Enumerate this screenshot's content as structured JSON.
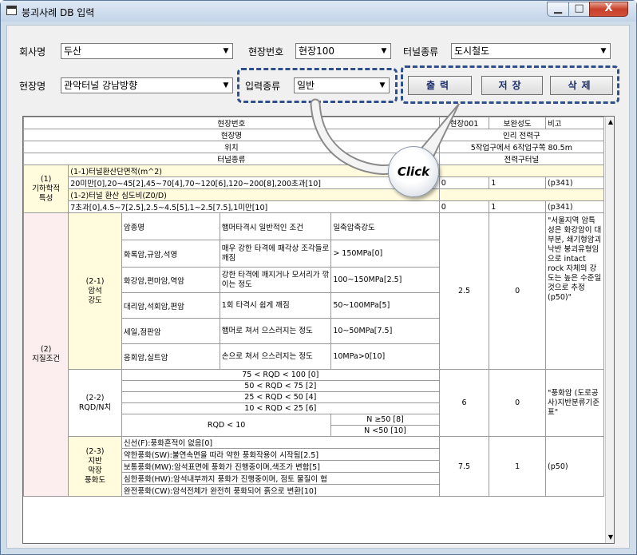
{
  "window": {
    "title": "붕괴사례 DB 입력",
    "min": "▁",
    "max": "□",
    "close": "X"
  },
  "form": {
    "company_label": "회사명",
    "company_value": "두산",
    "site_no_label": "현장번호",
    "site_no_value": "현장100",
    "tunnel_type_label": "터널종류",
    "tunnel_type_value": "도시철도",
    "site_name_label": "현장명",
    "site_name_value": "관악터널 강남방향",
    "input_type_label": "입력종류",
    "input_type_value": "일반"
  },
  "actions": {
    "print": "출력",
    "save": "저장",
    "delete": "삭제"
  },
  "overlay": {
    "click": "Click"
  },
  "grid": {
    "header": [
      {
        "label": "현장번호",
        "c1": "현장001",
        "c2": "보완성도",
        "c3": "비고"
      },
      {
        "label": "현장명",
        "value": "인리 전력구"
      },
      {
        "label": "위치",
        "value": "5작업구에서 6작업구쪽 80.5m"
      },
      {
        "label": "터널종류",
        "value": "전력구터널"
      }
    ],
    "geo": {
      "label": "(1)\n기하학적\n특성",
      "r1": "(1-1)터널환산단면적(m^2)",
      "r2": "20미만[0],20~45[2],45~70[4],70~120[6],120~200[8],200초과[10]",
      "r2_vals": [
        "0",
        "1",
        "(p341)"
      ],
      "r3": "(1-2)터널 환산 심도비(Z0/D)",
      "r4": "7초과[0],4.5~7[2.5],2.5~4.5[5],1~2.5[7.5],1미만[10]",
      "r4_vals": [
        "0",
        "1",
        "(p341)"
      ]
    },
    "ground": {
      "label": "(2)\n지질조건",
      "strength": {
        "label": "(2-1)\n암석\n강도",
        "col_heads": [
          "암종명",
          "햄머타격시 일반적인 조건",
          "일축압축강도"
        ],
        "rows": [
          [
            "화록암,규암,석영",
            "매우 강한 타격에 패각상 조각들로 깨짐",
            "> 150MPa[0]"
          ],
          [
            "화강암,편마암,역암",
            "강한 타격에 깨지거나 모서리가 깎이는 정도",
            "100~150MPa[2.5]"
          ],
          [
            "대리암,석회암,편암",
            "1회 타격시 쉽게 깨짐",
            "50~100MPa[5]"
          ],
          [
            "세일,점판암",
            "햄머로 쳐서 으스러지는 정도",
            "10~50MPa[7.5]"
          ],
          [
            "응회암,실트암",
            "손으로 쳐서 으스러지는 정도",
            "10MPa>0[10]"
          ]
        ],
        "v1": "2.5",
        "v2": "0",
        "note": "\"서울지역 암특성은 화강암이 대부분, 쇄기형암괴 낙반 붕괴유형임으로 intact rock 자체의 강도는 높은 수준일 것으로 추정(p50)\""
      },
      "rqd": {
        "label": "(2-2)\nRQD/N치",
        "rows": [
          "75 < RQD < 100 [0]",
          "50 < RQD < 75 [2]",
          "25 < RQD < 50 [4]",
          "10 < RQD < 25 [6]"
        ],
        "low": "RQD < 10",
        "n1": "N ≥50 [8]",
        "n2": "N <50 [10]",
        "v1": "6",
        "v2": "0",
        "note": "\"풍화암 (도로공사)지반분류기준표\""
      },
      "weather": {
        "label": "(2-3)\n지반\n막장\n풍화도",
        "rows": [
          "신선(F):풍화흔적이 없음[0]",
          "약한풍화(SW):불연속면을 따라 약한 풍화작용이 시작됨[2.5]",
          "보통풍화(MW):암석표면에 풍화가 진행중이며,색조가 변함[5]",
          "심한풍화(HW):암석내부까지 풍화가 진행중이며, 점토 물질이 협",
          "완전풍화(CW):암석전체가 완전히 풍화되어 흙으로 변환[10]"
        ],
        "v1": "7.5",
        "v2": "1",
        "note": "(p50)"
      }
    }
  }
}
